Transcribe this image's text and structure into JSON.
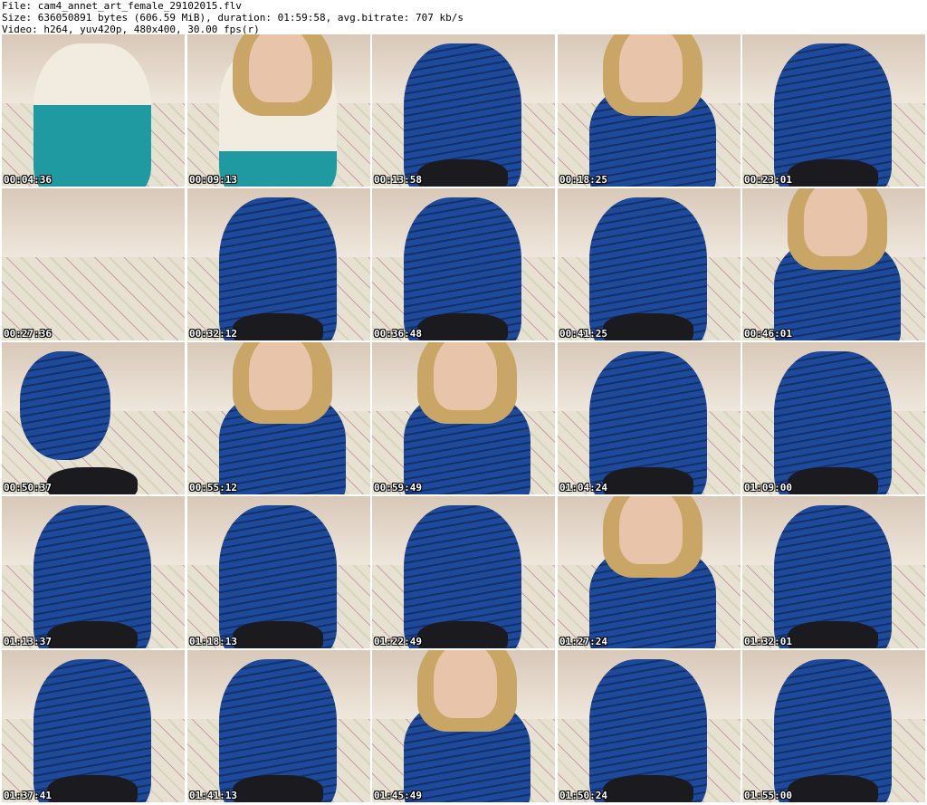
{
  "header": {
    "file_line": "File: cam4_annet_art_female_29102015.flv",
    "size_line": "Size: 636050891 bytes (606.59 MiB), duration: 01:59:58, avg.bitrate: 707 kb/s",
    "video_line": "Video: h264, yuv420p, 480x400, 30.00 fps(r)"
  },
  "colors": {
    "dress": "#1d4a9a",
    "dress_dark": "#14306a",
    "skin": "#e8c4aa",
    "hair": "#c9a566",
    "sofa": "#e6e1d0",
    "wall": "#d8c8b8"
  },
  "thumbnails": [
    {
      "timestamp": "00:04:36",
      "variant": "teal"
    },
    {
      "timestamp": "00:09:13",
      "variant": "teal-face"
    },
    {
      "timestamp": "00:13:58",
      "variant": "body"
    },
    {
      "timestamp": "00:18:25",
      "variant": "face"
    },
    {
      "timestamp": "00:23:01",
      "variant": "body"
    },
    {
      "timestamp": "00:27:36",
      "variant": "sofa"
    },
    {
      "timestamp": "00:32:12",
      "variant": "body"
    },
    {
      "timestamp": "00:36:48",
      "variant": "body"
    },
    {
      "timestamp": "00:41:25",
      "variant": "body"
    },
    {
      "timestamp": "00:46:01",
      "variant": "face"
    },
    {
      "timestamp": "00:50:37",
      "variant": "back"
    },
    {
      "timestamp": "00:55:12",
      "variant": "face"
    },
    {
      "timestamp": "00:59:49",
      "variant": "face"
    },
    {
      "timestamp": "01:04:24",
      "variant": "body"
    },
    {
      "timestamp": "01:09:00",
      "variant": "body"
    },
    {
      "timestamp": "01:13:37",
      "variant": "body"
    },
    {
      "timestamp": "01:18:13",
      "variant": "body"
    },
    {
      "timestamp": "01:22:49",
      "variant": "body"
    },
    {
      "timestamp": "01:27:24",
      "variant": "face"
    },
    {
      "timestamp": "01:32:01",
      "variant": "body"
    },
    {
      "timestamp": "01:37:41",
      "variant": "body"
    },
    {
      "timestamp": "01:41:13",
      "variant": "body"
    },
    {
      "timestamp": "01:45:49",
      "variant": "face"
    },
    {
      "timestamp": "01:50:24",
      "variant": "body"
    },
    {
      "timestamp": "01:55:00",
      "variant": "body"
    }
  ]
}
